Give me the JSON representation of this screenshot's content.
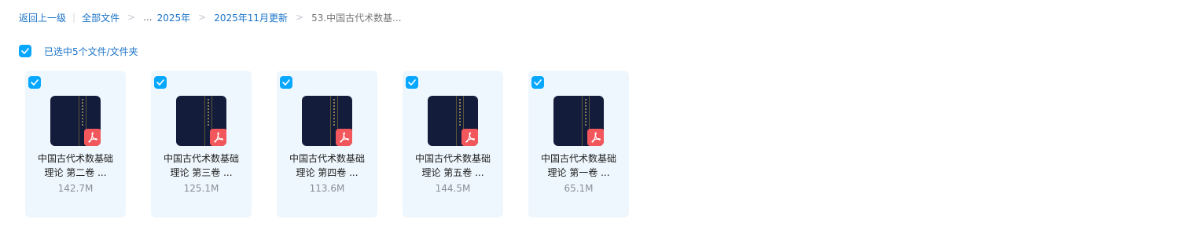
{
  "breadcrumb": {
    "back": "返回上一级",
    "all_files": "全部文件",
    "ellipsis": "...",
    "year": "2025年",
    "month": "2025年11月更新",
    "current": "53.中国古代术数基..."
  },
  "selection": {
    "label": "已选中5个文件/文件夹",
    "checked": true
  },
  "files": [
    {
      "name_line1": "中国古代术数基础",
      "name_line2": "理论 第二卷 ...",
      "size": "142.7M",
      "type": "pdf",
      "checked": true
    },
    {
      "name_line1": "中国古代术数基础",
      "name_line2": "理论 第三卷 ...",
      "size": "125.1M",
      "type": "pdf",
      "checked": true
    },
    {
      "name_line1": "中国古代术数基础",
      "name_line2": "理论 第四卷 ...",
      "size": "113.6M",
      "type": "pdf",
      "checked": true
    },
    {
      "name_line1": "中国古代术数基础",
      "name_line2": "理论 第五卷 ...",
      "size": "144.5M",
      "type": "pdf",
      "checked": true
    },
    {
      "name_line1": "中国古代术数基础",
      "name_line2": "理论 第一卷 ...",
      "size": "65.1M",
      "type": "pdf",
      "checked": true
    }
  ],
  "colors": {
    "accent": "#06a7ff",
    "link": "#1a73c8",
    "card_bg": "#eef7fd",
    "pdf_badge": "#f2575b",
    "thumb_bg": "#141c3c"
  }
}
